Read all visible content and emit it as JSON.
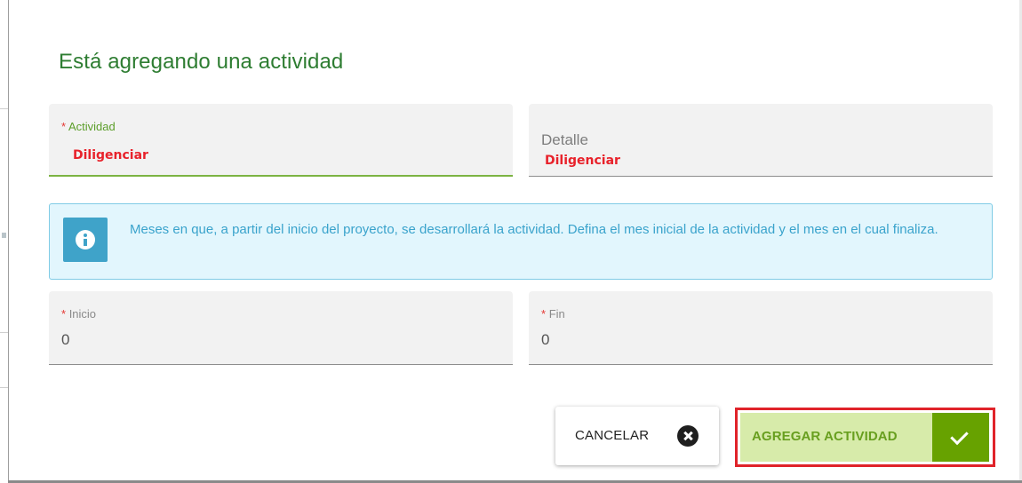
{
  "dialog": {
    "title": "Está agregando una actividad"
  },
  "fields": {
    "actividad": {
      "required_mark": "*",
      "label": "Actividad",
      "hint": "Diligenciar"
    },
    "detalle": {
      "label": "Detalle",
      "hint": "Diligenciar"
    },
    "inicio": {
      "required_mark": "*",
      "label": "Inicio",
      "value": "0"
    },
    "fin": {
      "required_mark": "*",
      "label": "Fin",
      "value": "0"
    }
  },
  "info": {
    "icon": "info-icon",
    "text": "Meses en que, a partir del inicio del proyecto, se desarrollará la actividad. Defina el mes inicial de la actividad y el mes en el cual finaliza."
  },
  "actions": {
    "cancel_label": "CANCELAR",
    "cancel_icon": "close-circle-icon",
    "add_label": "AGREGAR ACTIVIDAD",
    "add_icon": "check-icon"
  },
  "colors": {
    "title": "#2e7d32",
    "accent_green": "#67a200",
    "highlight_red": "#e0232a",
    "info_blue": "#3fa3c9"
  }
}
